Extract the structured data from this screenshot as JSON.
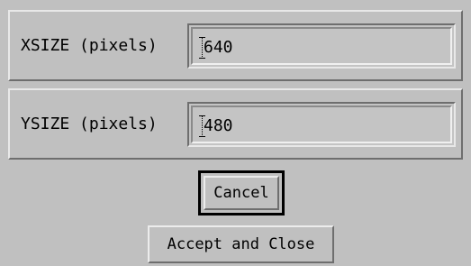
{
  "dialog": {
    "xsize": {
      "label": "XSIZE (pixels)",
      "value": "640"
    },
    "ysize": {
      "label": "YSIZE (pixels)",
      "value": "480"
    },
    "buttons": {
      "cancel": "Cancel",
      "accept": "Accept and Close"
    }
  }
}
